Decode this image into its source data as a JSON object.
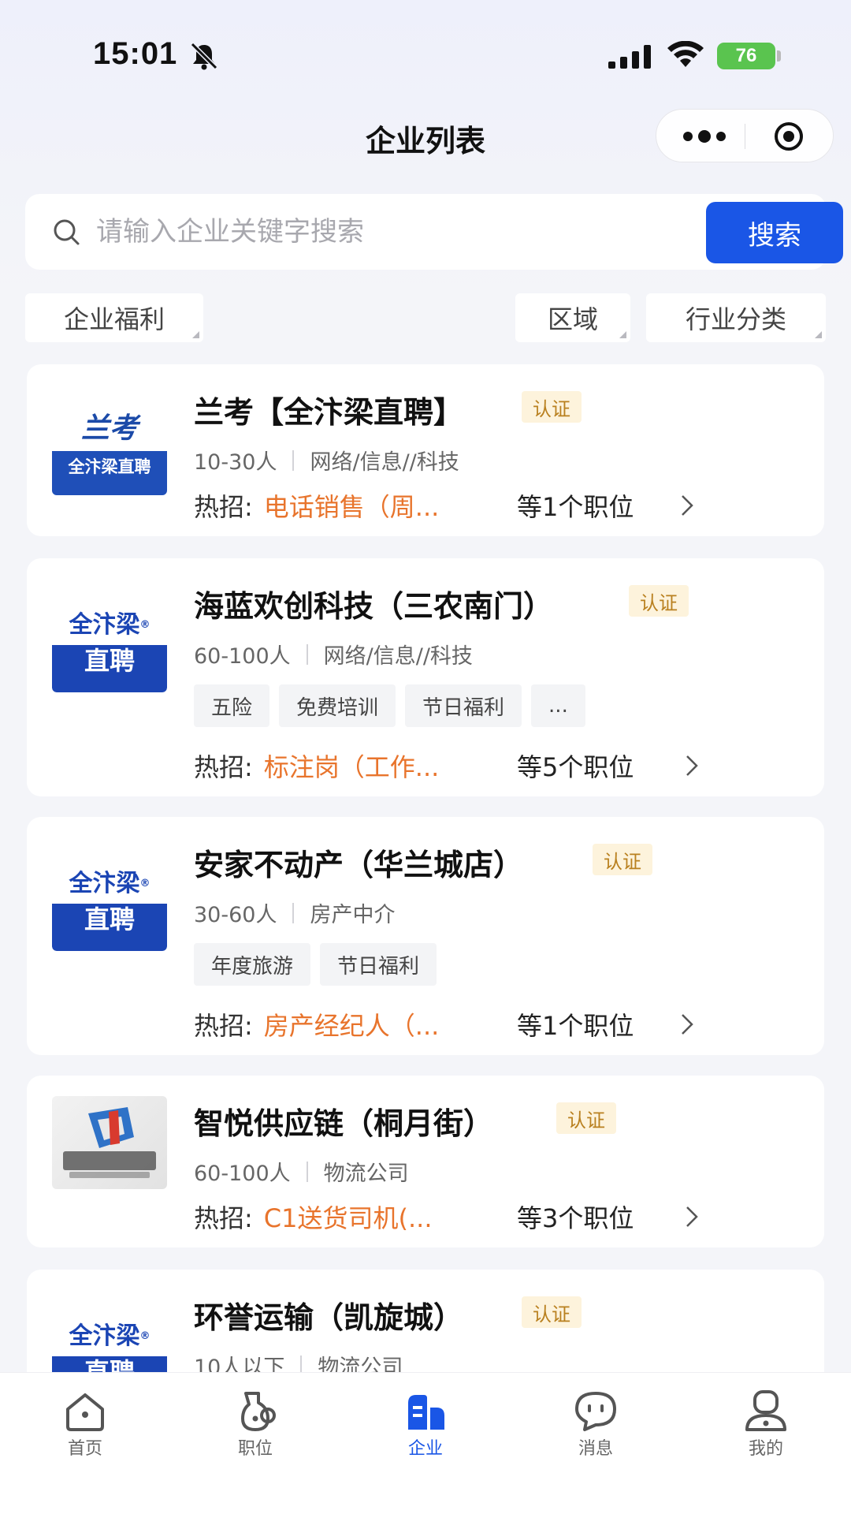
{
  "status_bar": {
    "time": "15:01",
    "battery": "76"
  },
  "nav": {
    "title": "企业列表"
  },
  "search": {
    "placeholder": "请输入企业关键字搜索",
    "button": "搜索"
  },
  "filters": {
    "benefits": "企业福利",
    "region": "区域",
    "industry": "行业分类"
  },
  "cert_label": "认证",
  "hot_prefix": "热招:",
  "logos": {
    "lankao_top": "兰考",
    "lankao_bottom": "全汴梁直聘",
    "qbl_top": "全汴梁",
    "qbl_reg": "®",
    "qbl_bottom": "直聘"
  },
  "companies": [
    {
      "name": "兰考【全汴梁直聘】",
      "size": "10-30人",
      "industry": "网络/信息//科技",
      "tags": [],
      "hot_job": "电话销售（周...",
      "job_count": "等1个职位"
    },
    {
      "name": "海蓝欢创科技（三农南门）",
      "size": "60-100人",
      "industry": "网络/信息//科技",
      "tags": [
        "五险",
        "免费培训",
        "节日福利",
        "..."
      ],
      "hot_job": "标注岗（工作...",
      "job_count": "等5个职位"
    },
    {
      "name": "安家不动产（华兰城店）",
      "size": "30-60人",
      "industry": "房产中介",
      "tags": [
        "年度旅游",
        "节日福利"
      ],
      "hot_job": "房产经纪人（...",
      "job_count": "等1个职位"
    },
    {
      "name": "智悦供应链（桐月街）",
      "size": "60-100人",
      "industry": "物流公司",
      "tags": [],
      "hot_job": "C1送货司机(...",
      "job_count": "等3个职位"
    },
    {
      "name": "环誉运输（凯旋城）",
      "size": "10人以下",
      "industry": "物流公司",
      "tags": [],
      "hot_job": "",
      "job_count": ""
    }
  ],
  "tabbar": [
    {
      "label": "首页",
      "icon": "home-icon"
    },
    {
      "label": "职位",
      "icon": "job-icon"
    },
    {
      "label": "企业",
      "icon": "company-icon"
    },
    {
      "label": "消息",
      "icon": "message-icon"
    },
    {
      "label": "我的",
      "icon": "profile-icon"
    }
  ],
  "colors": {
    "accent": "#1a56e6",
    "hot_job": "#e8742c",
    "badge_bg": "#fdf3dc",
    "badge_text": "#b9801f",
    "battery": "#5ac44f"
  }
}
